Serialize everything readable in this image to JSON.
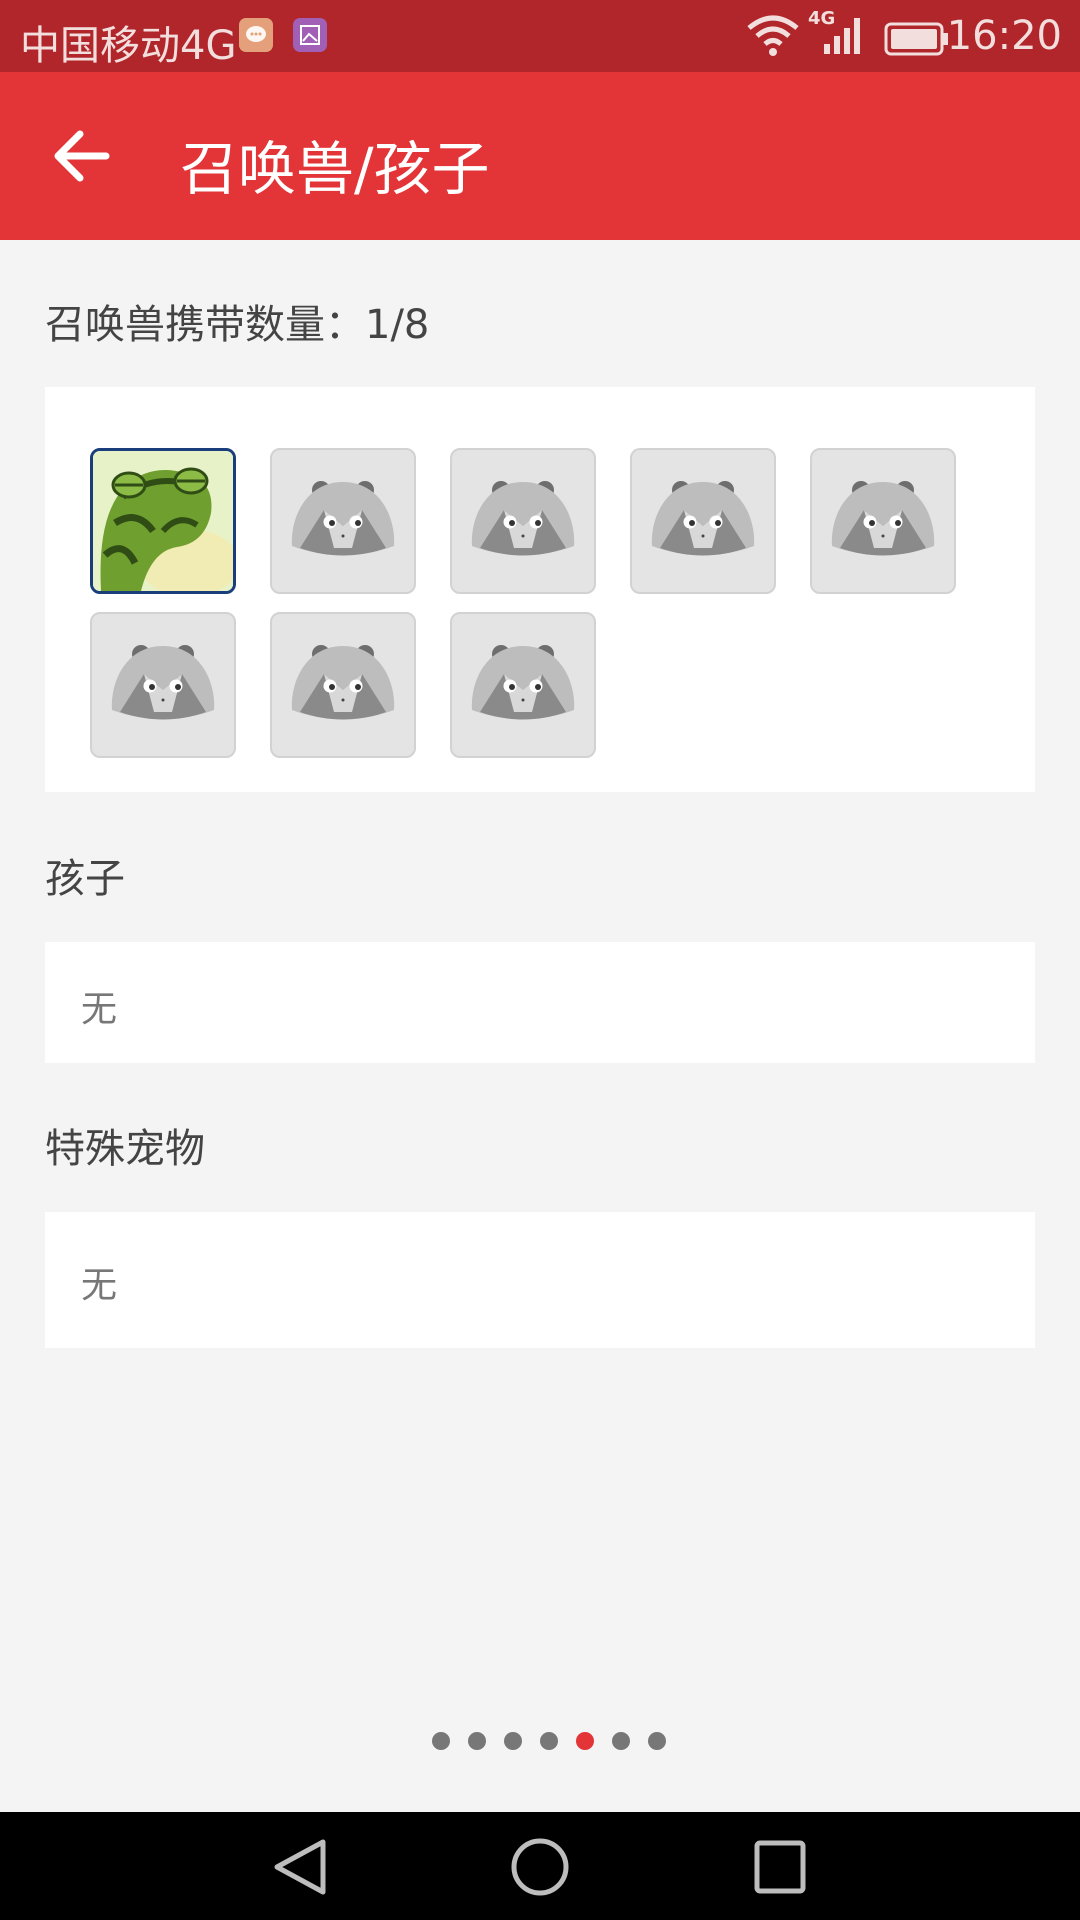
{
  "status_bar": {
    "carrier": "中国移动4G",
    "network_badge": "4G",
    "time": "16:20",
    "icons": [
      "message-notification-icon",
      "gallery-notification-icon",
      "wifi-icon",
      "signal-icon",
      "battery-icon"
    ]
  },
  "app_bar": {
    "title": "召唤兽/孩子",
    "back_icon": "arrow-left-icon",
    "background": "#e33538"
  },
  "summons": {
    "label": "召唤兽携带数量：1/8",
    "slots": [
      {
        "state": "filled",
        "icon": "green-frog-pet-avatar"
      },
      {
        "state": "empty",
        "icon": "placeholder-panda-icon"
      },
      {
        "state": "empty",
        "icon": "placeholder-panda-icon"
      },
      {
        "state": "empty",
        "icon": "placeholder-panda-icon"
      },
      {
        "state": "empty",
        "icon": "placeholder-panda-icon"
      },
      {
        "state": "empty",
        "icon": "placeholder-panda-icon"
      },
      {
        "state": "empty",
        "icon": "placeholder-panda-icon"
      },
      {
        "state": "empty",
        "icon": "placeholder-panda-icon"
      }
    ]
  },
  "children": {
    "label": "孩子",
    "value": "无"
  },
  "special_pets": {
    "label": "特殊宠物",
    "value": "无"
  },
  "pager": {
    "total": 7,
    "active_index": 4,
    "active_color": "#e33538"
  },
  "nav_bar": {
    "icons": [
      "nav-back-icon",
      "nav-home-icon",
      "nav-recents-icon"
    ]
  }
}
